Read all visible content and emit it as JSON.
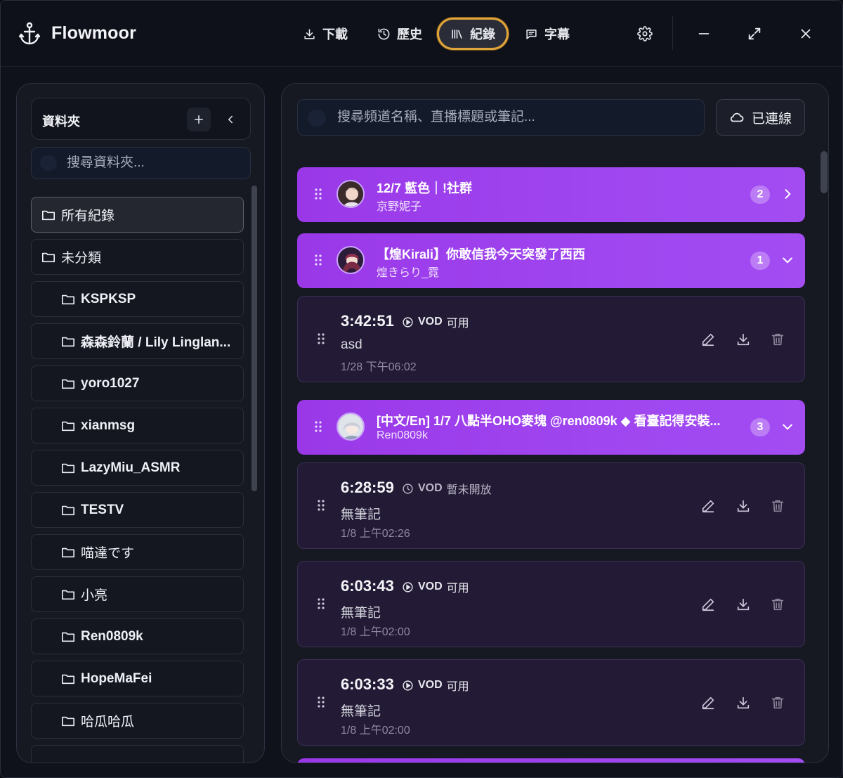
{
  "app": {
    "name": "Flowmoor"
  },
  "nav": {
    "tabs": [
      {
        "label": "下載",
        "icon": "download-icon"
      },
      {
        "label": "歷史",
        "icon": "history-icon"
      },
      {
        "label": "紀錄",
        "icon": "library-icon",
        "active": true
      },
      {
        "label": "字幕",
        "icon": "subtitles-icon"
      }
    ]
  },
  "sidebar": {
    "title": "資料夾",
    "search_placeholder": "搜尋資料夾...",
    "folders": [
      {
        "label": "所有紀錄",
        "level": 0,
        "active": true
      },
      {
        "label": "未分類",
        "level": 0
      },
      {
        "label": "KSPKSP",
        "level": 1
      },
      {
        "label": "森森鈴蘭 / Lily Linglan...",
        "level": 1
      },
      {
        "label": "yoro1027",
        "level": 1
      },
      {
        "label": "xianmsg",
        "level": 1
      },
      {
        "label": "LazyMiu_ASMR",
        "level": 1
      },
      {
        "label": "TESTV",
        "level": 1
      },
      {
        "label": "喵達です",
        "level": 1
      },
      {
        "label": "小亮",
        "level": 1
      },
      {
        "label": "Ren0809k",
        "level": 1
      },
      {
        "label": "HopeMaFei",
        "level": 1
      },
      {
        "label": "哈瓜哈瓜",
        "level": 1
      }
    ]
  },
  "main": {
    "search_placeholder": "搜尋頻道名稱、直播標題或筆記...",
    "connection_label": "已連線",
    "groups": [
      {
        "title": "12/7 藍色｜!社群",
        "channel": "京野妮子",
        "count": "2",
        "expanded": false
      },
      {
        "title": "【煌Kirali】你敢信我今天突發了西西",
        "channel": "煌きらり_霓",
        "count": "1",
        "expanded": true
      },
      {
        "title": "[中文/En] 1/7 八點半OHO麥塊 @ren0809k ◆ 看臺記得安裝...",
        "channel": "Ren0809k",
        "count": "3",
        "expanded": true
      }
    ],
    "records": [
      {
        "time": "3:42:51",
        "vod_label": "VOD",
        "vod_status": "可用",
        "vod_icon": "play-circle-icon",
        "note": "asd",
        "date": "1/28 下午06:02"
      },
      {
        "time": "6:28:59",
        "vod_label": "VOD",
        "vod_status": "暫未開放",
        "vod_icon": "clock-icon",
        "note": "無筆記",
        "date": "1/8 上午02:26"
      },
      {
        "time": "6:03:43",
        "vod_label": "VOD",
        "vod_status": "可用",
        "vod_icon": "play-circle-icon",
        "note": "無筆記",
        "date": "1/8 上午02:00"
      },
      {
        "time": "6:03:33",
        "vod_label": "VOD",
        "vod_status": "可用",
        "vod_icon": "play-circle-icon",
        "note": "無筆記",
        "date": "1/8 上午02:00"
      }
    ]
  },
  "colors": {
    "accent": "#e0a43a",
    "group_purple": "#9f46f0",
    "record_bg": "#231a35",
    "panel_bg": "#161922"
  }
}
